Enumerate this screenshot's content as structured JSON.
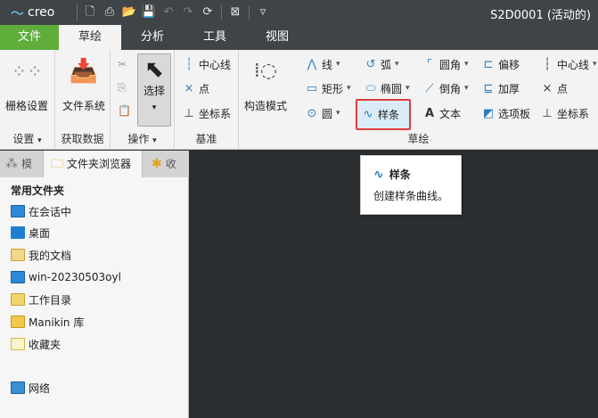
{
  "titlebar": {
    "app_name": "creo",
    "window_title": "S2D0001 (活动的)"
  },
  "tabs": [
    "文件",
    "草绘",
    "分析",
    "工具",
    "视图"
  ],
  "ribbon": {
    "settings": {
      "grid_label": "栅格设置",
      "group": "设置"
    },
    "getdata": {
      "filesys_label": "文件系统",
      "group": "获取数据"
    },
    "operations": {
      "select_label": "选择",
      "group": "操作"
    },
    "datum": {
      "centerline": "中心线",
      "point": "点",
      "coordsys": "坐标系",
      "group": "基准"
    },
    "sketch": {
      "construction_label": "构造模式",
      "line": "线",
      "arc": "弧",
      "fillet": "圆角",
      "offset": "偏移",
      "rectangle": "矩形",
      "ellipse": "椭圆",
      "chamfer": "倒角",
      "thicken": "加厚",
      "circle": "圆",
      "spline": "样条",
      "text": "文本",
      "palette": "选项板",
      "centerline": "中心线",
      "point": "点",
      "coordsys": "坐标系",
      "group": "草绘"
    }
  },
  "tooltip": {
    "title": "样条",
    "description": "创建样条曲线。"
  },
  "panel": {
    "tabs": [
      "模",
      "文件夹浏览器",
      "收"
    ],
    "heading": "常用文件夹",
    "items": [
      {
        "label": "在会话中",
        "icon": "monitor-icon"
      },
      {
        "label": "桌面",
        "icon": "desktop-icon"
      },
      {
        "label": "我的文档",
        "icon": "documents-icon"
      },
      {
        "label": "win-20230503oyl",
        "icon": "computer-icon"
      },
      {
        "label": "工作目录",
        "icon": "working-dir-icon"
      },
      {
        "label": "Manikin 库",
        "icon": "library-icon"
      },
      {
        "label": "收藏夹",
        "icon": "favorites-icon"
      },
      {
        "label": "网络",
        "icon": "network-icon"
      }
    ]
  },
  "colors": {
    "titlebar_bg": "#3f4448",
    "file_tab": "#5fae3c",
    "ribbon_bg": "#f3f3f3",
    "highlight_border": "#e03c3c",
    "viewport_bg": "#2b2e31"
  }
}
